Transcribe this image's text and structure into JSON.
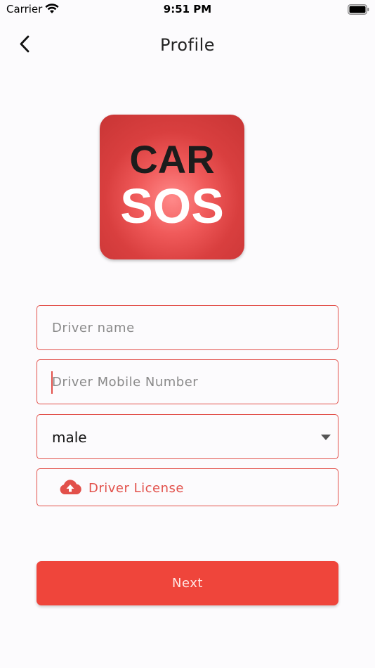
{
  "status_bar": {
    "carrier": "Carrier",
    "time": "9:51 PM"
  },
  "header": {
    "title": "Profile",
    "back_icon": "chevron-left-icon"
  },
  "logo": {
    "line1": "CAR",
    "line2": "SOS"
  },
  "form": {
    "driver_name": {
      "value": "",
      "placeholder": "Driver name"
    },
    "driver_mobile": {
      "value": "",
      "placeholder": "Driver Mobile Number",
      "focused": true
    },
    "gender": {
      "selected": "male",
      "icon": "caret-down-icon"
    },
    "license": {
      "label": "Driver License",
      "icon": "cloud-upload-icon"
    }
  },
  "actions": {
    "next_label": "Next"
  },
  "colors": {
    "accent": "#e2504a",
    "button": "#ef453b",
    "background": "#fcfbfd"
  }
}
